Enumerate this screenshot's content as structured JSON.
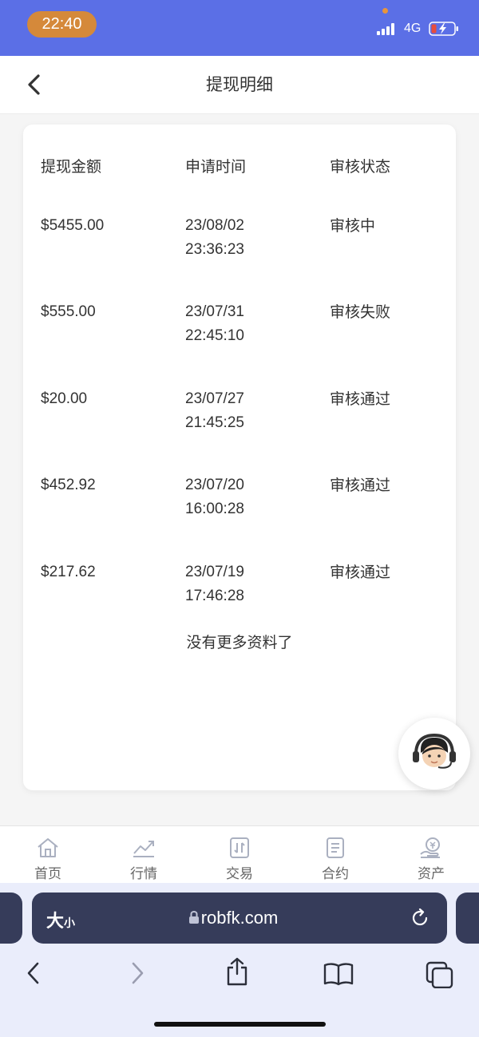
{
  "status_bar": {
    "time": "22:40",
    "network": "4G",
    "colors": {
      "bar": "#5b6fe6",
      "time_pill": "#d5893a",
      "battery_low": "#e74c3c"
    }
  },
  "header": {
    "title": "提现明细",
    "back_icon": "chevron-left-icon"
  },
  "table": {
    "columns": [
      "提现金额",
      "申请时间",
      "审核状态"
    ],
    "rows": [
      {
        "amount": "$5455.00",
        "date": "23/08/02",
        "time": "23:36:23",
        "status": "审核中"
      },
      {
        "amount": "$555.00",
        "date": "23/07/31",
        "time": "22:45:10",
        "status": "审核失败"
      },
      {
        "amount": "$20.00",
        "date": "23/07/27",
        "time": "21:45:25",
        "status": "审核通过"
      },
      {
        "amount": "$452.92",
        "date": "23/07/20",
        "time": "16:00:28",
        "status": "审核通过"
      },
      {
        "amount": "$217.62",
        "date": "23/07/19",
        "time": "17:46:28",
        "status": "审核通过"
      }
    ],
    "footer": "没有更多资料了"
  },
  "support": {
    "icon": "customer-service-avatar-icon"
  },
  "tabbar": {
    "items": [
      {
        "label": "首页",
        "icon": "home-icon"
      },
      {
        "label": "行情",
        "icon": "market-chart-icon"
      },
      {
        "label": "交易",
        "icon": "trade-icon"
      },
      {
        "label": "合约",
        "icon": "contract-icon"
      },
      {
        "label": "资产",
        "icon": "assets-icon"
      }
    ]
  },
  "browser": {
    "text_size_big": "大",
    "text_size_small": "小",
    "url": "robfk.com",
    "icons": [
      "lock-icon",
      "reload-icon",
      "back-icon",
      "forward-icon",
      "share-icon",
      "bookmarks-icon",
      "tabs-icon"
    ]
  }
}
